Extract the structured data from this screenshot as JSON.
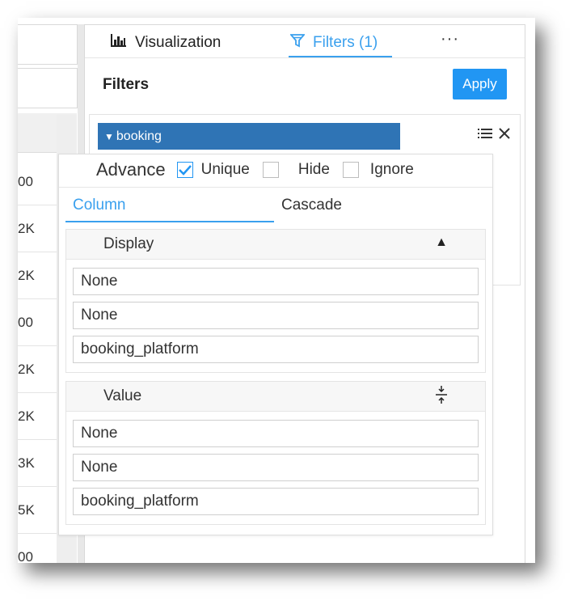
{
  "tabs": {
    "visualization": "Visualization",
    "filters": "Filters (1)",
    "more": "···"
  },
  "filters_heading": "Filters",
  "apply_label": "Apply",
  "filter": {
    "name": "booking"
  },
  "advance": {
    "label": "Advance",
    "options": [
      {
        "label": "Unique",
        "checked": true
      },
      {
        "label": "Hide",
        "checked": false
      },
      {
        "label": "Ignore",
        "checked": false
      }
    ]
  },
  "subtabs": {
    "column": "Column",
    "cascade": "Cascade"
  },
  "display": {
    "label": "Display",
    "fields": [
      "None",
      "None",
      "booking_platform"
    ]
  },
  "value": {
    "label": "Value",
    "fields": [
      "None",
      "None",
      "booking_platform"
    ]
  },
  "left_values": [
    "00",
    "2K",
    "2K",
    "00",
    "2K",
    "2K",
    "3K",
    "5K",
    "00"
  ],
  "colors": {
    "accent": "#2196f3",
    "filter_bar": "#2f74b5",
    "tab_active": "#3aa0ee"
  }
}
